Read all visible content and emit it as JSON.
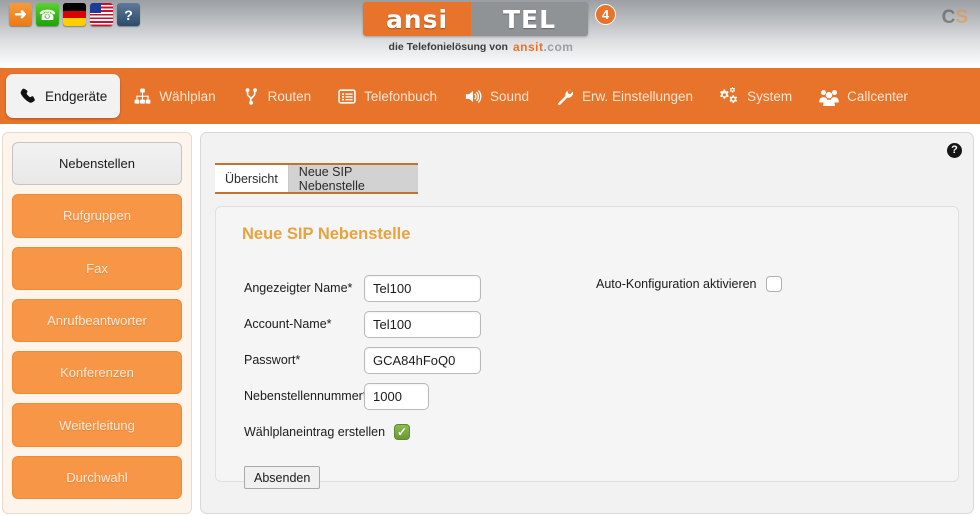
{
  "header": {
    "toolbar_icons": [
      {
        "name": "logout-icon",
        "title": "Logout"
      },
      {
        "name": "phone-icon",
        "title": "Anruf"
      },
      {
        "name": "flag-de-icon",
        "title": "Deutsch"
      },
      {
        "name": "flag-us-icon",
        "title": "English"
      },
      {
        "name": "help-book-icon",
        "title": "Hilfe"
      }
    ],
    "logo": {
      "left": "ansi",
      "right": "TEL",
      "badge": "4",
      "tagline_prefix": "die Telefonielösung von",
      "tagline_brand": "ansit",
      "tagline_brand_suffix": ".com"
    },
    "watermark": {
      "c": "C",
      "s": "S"
    }
  },
  "nav": {
    "items": [
      {
        "label": "Endgeräte",
        "icon": "phone-handset-icon",
        "active": true
      },
      {
        "label": "Wählplan",
        "icon": "sitemap-icon",
        "active": false
      },
      {
        "label": "Routen",
        "icon": "route-branch-icon",
        "active": false
      },
      {
        "label": "Telefonbuch",
        "icon": "list-lines-icon",
        "active": false
      },
      {
        "label": "Sound",
        "icon": "speaker-icon",
        "active": false
      },
      {
        "label": "Erw. Einstellungen",
        "icon": "wrench-icon",
        "active": false
      },
      {
        "label": "System",
        "icon": "gears-icon",
        "active": false
      },
      {
        "label": "Callcenter",
        "icon": "users-group-icon",
        "active": false
      }
    ]
  },
  "sidebar": {
    "items": [
      {
        "label": "Nebenstellen",
        "active": true
      },
      {
        "label": "Rufgruppen",
        "active": false
      },
      {
        "label": "Fax",
        "active": false
      },
      {
        "label": "Anrufbeantworter",
        "active": false
      },
      {
        "label": "Konferenzen",
        "active": false
      },
      {
        "label": "Weiterleitung",
        "active": false
      },
      {
        "label": "Durchwahl",
        "active": false
      }
    ]
  },
  "content": {
    "help_icon_label": "?",
    "tabs": [
      {
        "label": "Übersicht",
        "selected": true
      },
      {
        "label": "Neue SIP Nebenstelle",
        "selected": false
      }
    ],
    "panel_title": "Neue SIP Nebenstelle",
    "fields": [
      {
        "label": "Angezeigter Name*",
        "value": "Tel100",
        "placeholder": ""
      },
      {
        "label": "Account-Name*",
        "value": "Tel100",
        "placeholder": ""
      },
      {
        "label": "Passwort*",
        "value": "GCA84hFoQ0",
        "placeholder": ""
      },
      {
        "label": "Nebenstellennummer*",
        "value": "1000",
        "placeholder": ""
      }
    ],
    "dialplan_checkbox": {
      "label": "Wählplaneintrag erstellen",
      "checked": true,
      "tick": "✓"
    },
    "autoconfig_checkbox": {
      "label": "Auto-Konfiguration aktivieren",
      "checked": false
    },
    "submit_label": "Absenden"
  },
  "colors": {
    "nav_orange": "#e8732a",
    "sidebar_orange": "#f79646",
    "panel_title": "#e8a33d",
    "tab_border": "#c2722c"
  }
}
